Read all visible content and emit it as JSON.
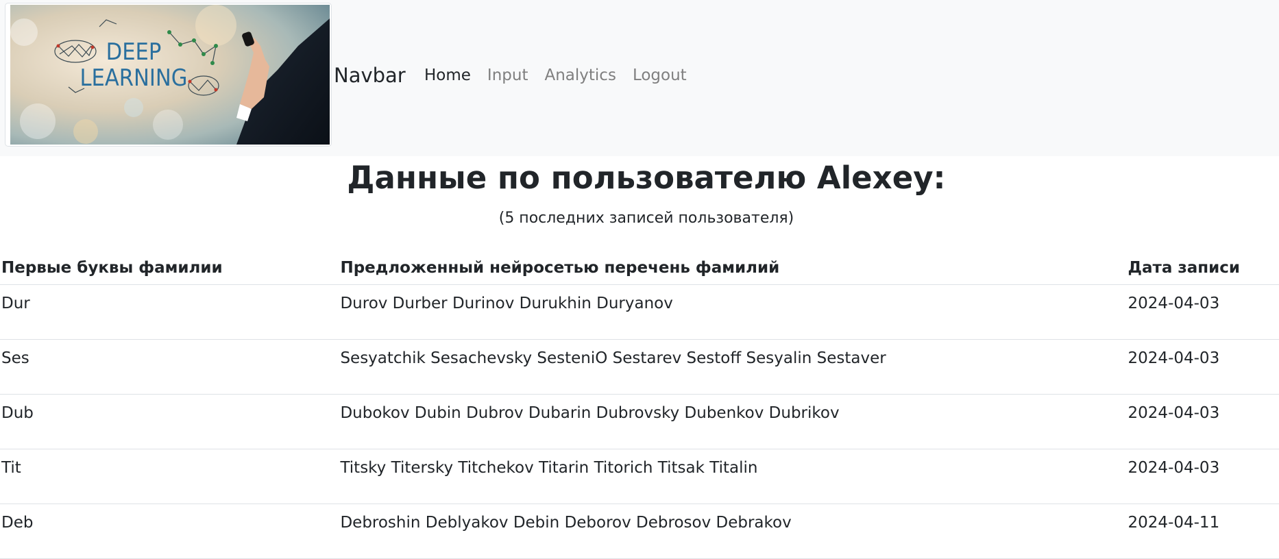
{
  "navbar": {
    "logo_text_line1": "DEEP",
    "logo_text_line2": "LEARNING",
    "brand": "Navbar",
    "links": [
      {
        "label": "Home",
        "active": true
      },
      {
        "label": "Input",
        "active": false
      },
      {
        "label": "Analytics",
        "active": false
      },
      {
        "label": "Logout",
        "active": false
      }
    ]
  },
  "main": {
    "title": "Данные по пользователю Alexey:",
    "subtitle": "(5 последних записей пользователя)",
    "table": {
      "headers": [
        "Первые буквы фамилии",
        "Предложенный нейросетью перечень фамилий",
        "Дата записи"
      ],
      "rows": [
        {
          "prefix": "Dur",
          "names": "Durov Durber Durinov Durukhin Duryanov",
          "date": "2024-04-03"
        },
        {
          "prefix": "Ses",
          "names": "Sesyatchik Sesachevsky SesteniO Sestarev Sestoff Sesyalin Sestaver",
          "date": "2024-04-03"
        },
        {
          "prefix": "Dub",
          "names": "Dubokov Dubin Dubrov Dubarin Dubrovsky Dubenkov Dubrikov",
          "date": "2024-04-03"
        },
        {
          "prefix": "Tit",
          "names": "Titsky Titersky Titchekov Titarin Titorich Titsak Titalin",
          "date": "2024-04-03"
        },
        {
          "prefix": "Deb",
          "names": "Debroshin Deblyakov Debin Deborov Debrosov Debrakov",
          "date": "2024-04-11"
        }
      ]
    }
  },
  "colors": {
    "navbar_bg": "#f8f9fa",
    "text": "#212529",
    "nav_inactive": "#7f7f7f",
    "logo_text": "#2a6f9e"
  }
}
